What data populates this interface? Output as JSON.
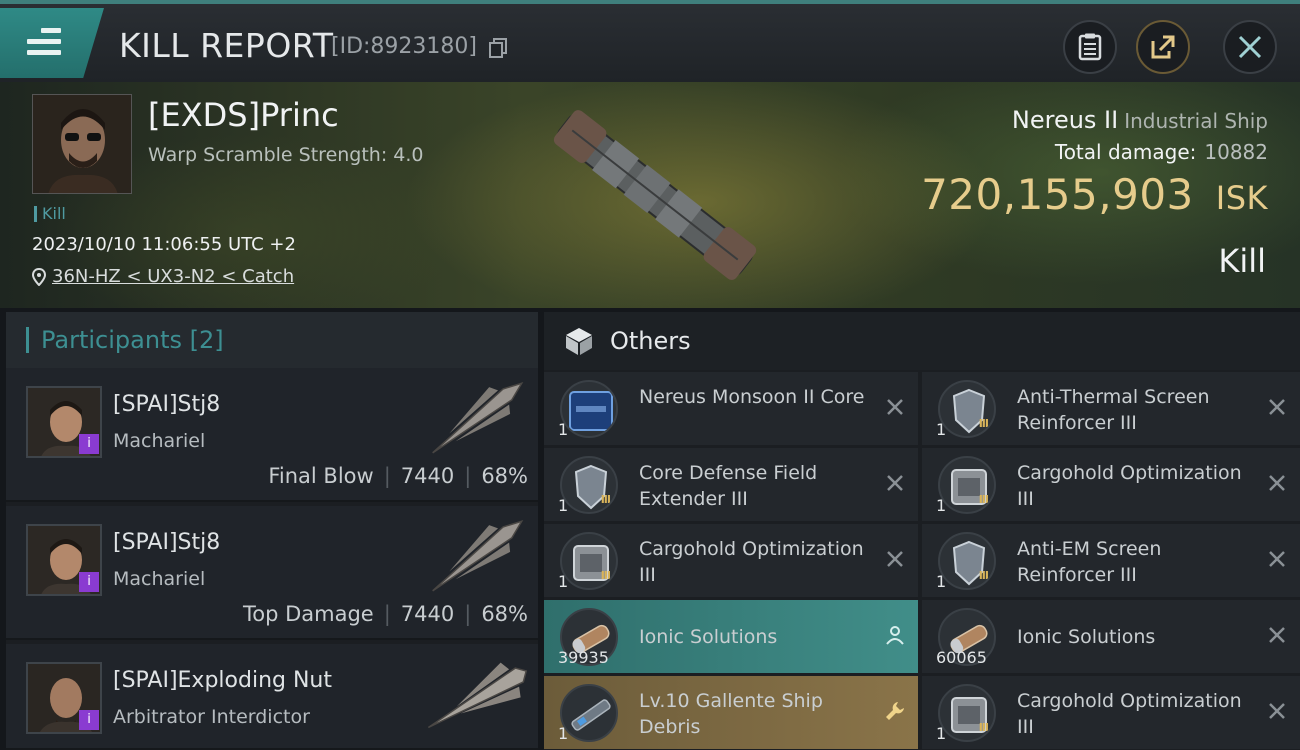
{
  "header": {
    "title": "KILL REPORT",
    "report_id": "[ID:8923180]"
  },
  "victim": {
    "name": "[EXDS]Princ",
    "warp_scramble": "Warp Scramble Strength: 4.0",
    "kill_tag": "Kill",
    "datetime": "2023/10/10 11:06:55 UTC +2",
    "location": "36N-HZ < UX3-N2 < Catch",
    "ship_name": "Nereus II",
    "ship_class": "Industrial Ship",
    "total_damage_label": "Total damage:",
    "total_damage": "10882",
    "isk_value": "720,155,903",
    "isk_unit": "ISK",
    "result": "Kill"
  },
  "participants": {
    "title": "Participants [2]",
    "list": [
      {
        "name": "[SPAI]Stj8",
        "ship": "Machariel",
        "role": "Final Blow",
        "damage": "7440",
        "percent": "68%"
      },
      {
        "name": "[SPAI]Stj8",
        "ship": "Machariel",
        "role": "Top Damage",
        "damage": "7440",
        "percent": "68%"
      },
      {
        "name": "[SPAI]Exploding Nut",
        "ship": "Arbitrator Interdictor"
      }
    ]
  },
  "others": {
    "title": "Others",
    "items": [
      {
        "qty": "1",
        "name": "Nereus Monsoon II Core"
      },
      {
        "qty": "1",
        "name": "Anti-Thermal Screen Reinforcer III"
      },
      {
        "qty": "1",
        "name": "Core Defense Field Extender III"
      },
      {
        "qty": "1",
        "name": "Cargohold Optimization III"
      },
      {
        "qty": "1",
        "name": "Cargohold Optimization III"
      },
      {
        "qty": "1",
        "name": "Anti-EM Screen Reinforcer III"
      },
      {
        "qty": "39935",
        "name": "Ionic Solutions"
      },
      {
        "qty": "60065",
        "name": "Ionic Solutions"
      },
      {
        "qty": "1",
        "name": "Lv.10 Gallente Ship Debris"
      },
      {
        "qty": "1",
        "name": "Cargohold Optimization III"
      }
    ]
  },
  "colors": {
    "accent_teal": "#3d8f92",
    "isk_gold": "#e6cc8c",
    "highlight_teal": "#418e89",
    "highlight_gold": "#8a7449"
  }
}
